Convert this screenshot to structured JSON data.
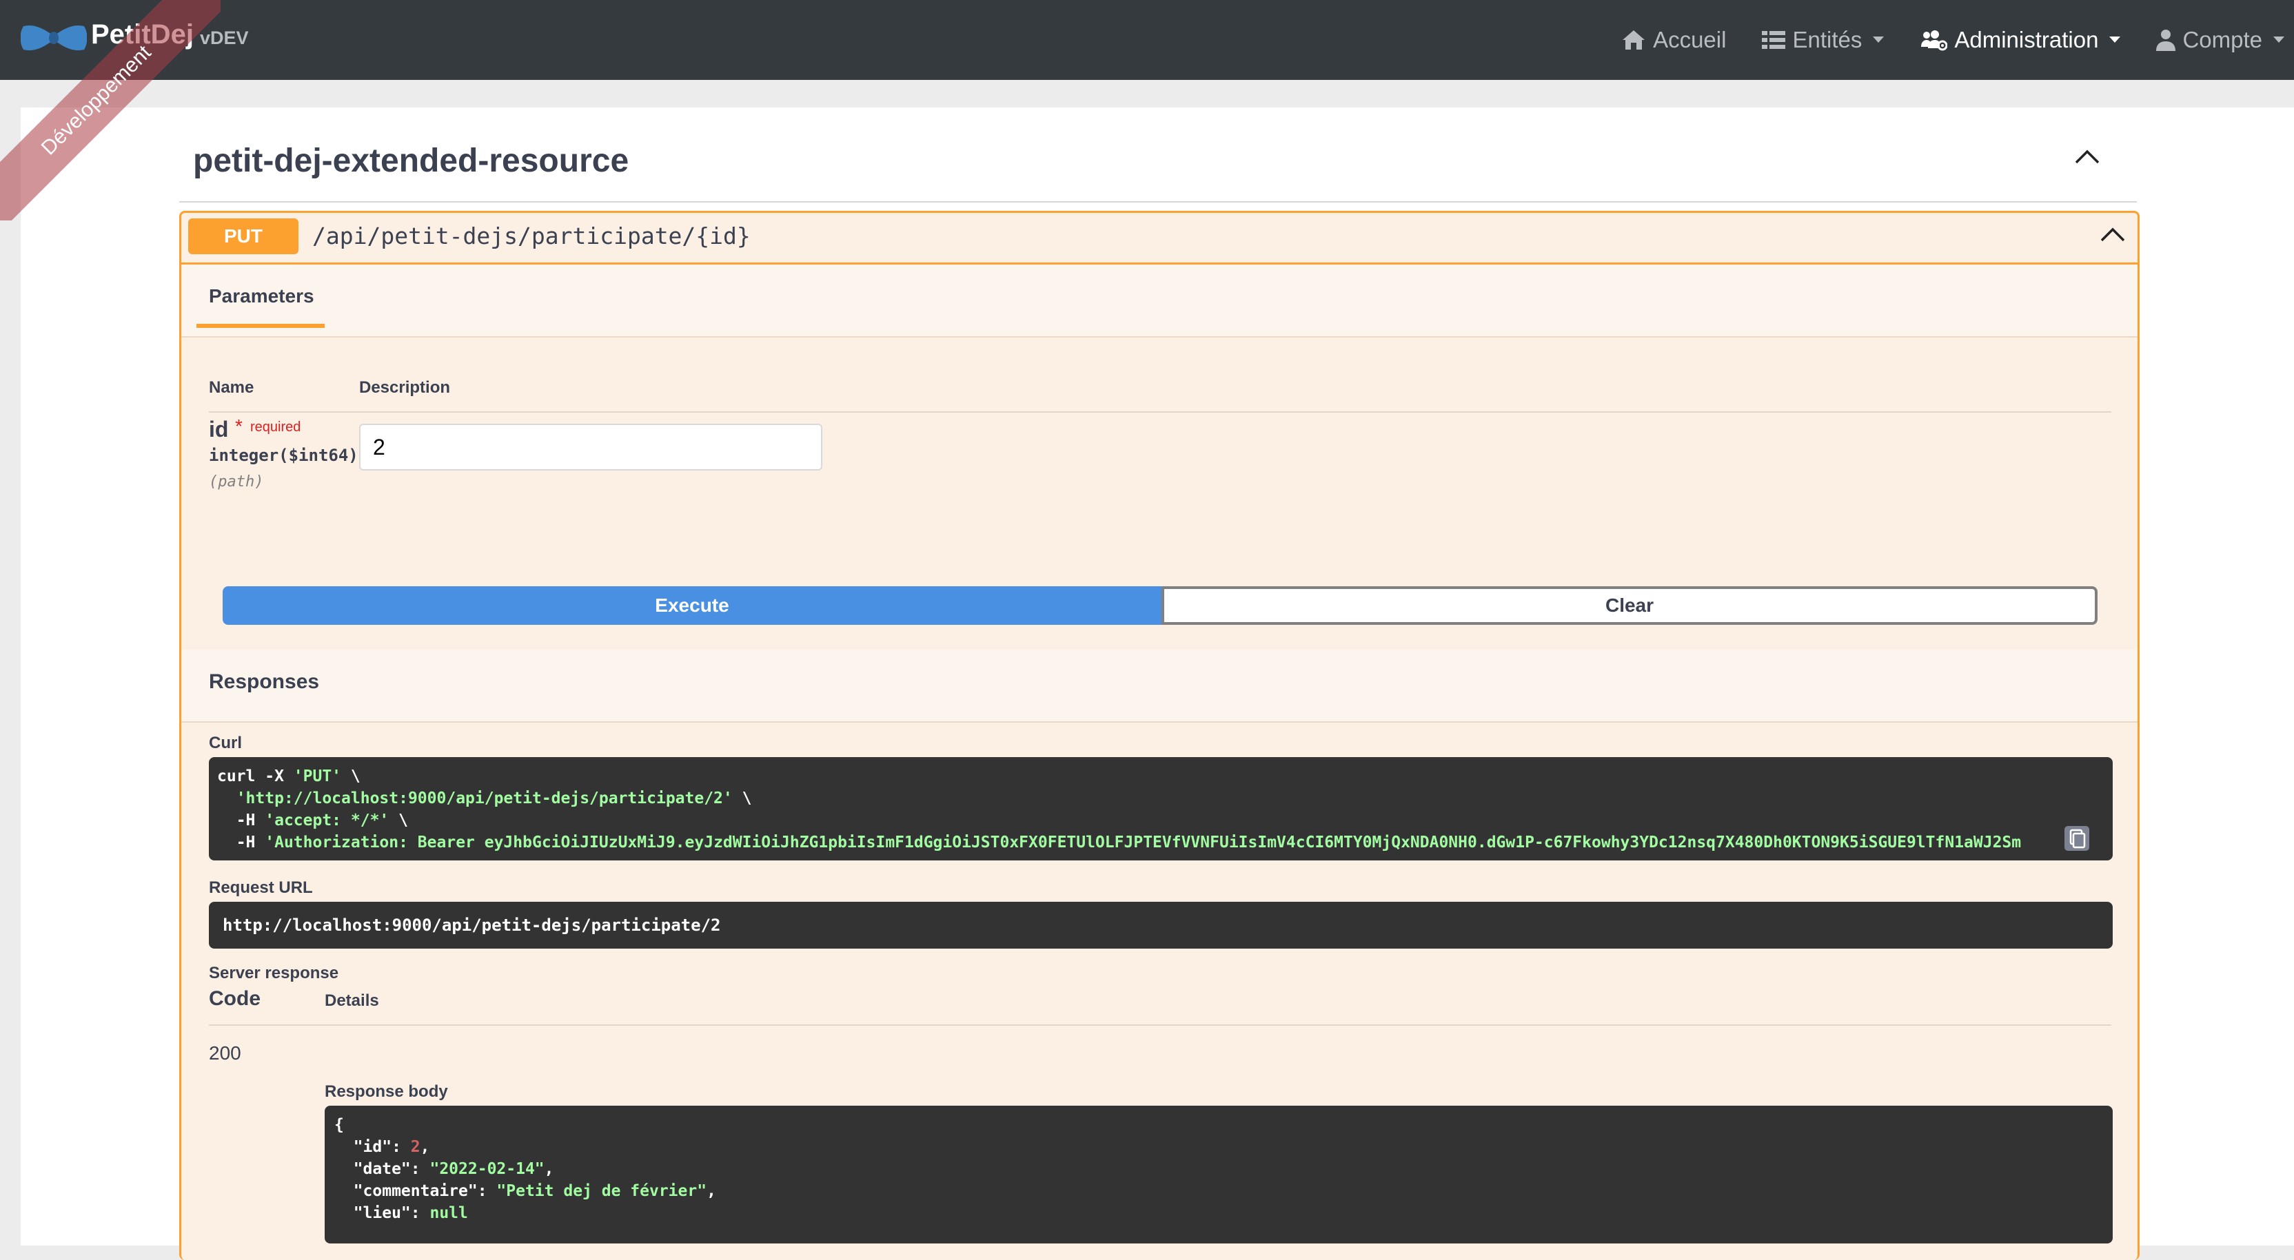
{
  "brand": {
    "name": "PetitDej",
    "version": "vDEV",
    "ribbon": "Développement"
  },
  "nav": {
    "home": "Accueil",
    "entities": "Entités",
    "admin": "Administration",
    "account": "Compte"
  },
  "tag": {
    "title": "petit-dej-extended-resource"
  },
  "operation": {
    "method": "PUT",
    "path": "/api/petit-dejs/participate/{id}",
    "tab_parameters": "Parameters"
  },
  "params": {
    "col_name": "Name",
    "col_description": "Description",
    "name": "id",
    "star": "*",
    "required": "required",
    "type": "integer($int64)",
    "in": "(path)",
    "value": "2"
  },
  "buttons": {
    "execute": "Execute",
    "clear": "Clear"
  },
  "responses": {
    "title": "Responses",
    "curl_label": "Curl",
    "curl": {
      "l1_a": "curl -X ",
      "l1_b": "'PUT'",
      "l1_c": " \\",
      "l2_a": "  ",
      "l2_b": "'http://localhost:9000/api/petit-dejs/participate/2'",
      "l2_c": " \\",
      "l3_a": "  -H ",
      "l3_b": "'accept: */*'",
      "l3_c": " \\",
      "l4_a": "  -H ",
      "l4_b": "'Authorization: Bearer eyJhbGciOiJIUzUxMiJ9.eyJzdWIiOiJhZG1pbiIsImF1dGgiOiJST0xFX0FETUlOLFJPTEVfVVNFUiIsImV4cCI6MTY0MjQxNDA0NH0.dGw1P-c67Fkowhy3YDc12nsq7X480Dh0KTON9K5iSGUE9lTfN1aWJ2Sm"
    },
    "request_url_label": "Request URL",
    "request_url": "http://localhost:9000/api/petit-dejs/participate/2",
    "server_response_label": "Server response",
    "col_code": "Code",
    "col_details": "Details",
    "code": "200",
    "body_label": "Response body",
    "body": {
      "open": "{",
      "id_key": "  \"id\"",
      "id_val": "2",
      "date_key": "  \"date\"",
      "date_val": "\"2022-02-14\"",
      "comment_key": "  \"commentaire\"",
      "comment_val": "\"Petit dej de février\"",
      "lieu_key": "  \"lieu\"",
      "lieu_val": "null"
    }
  },
  "colors": {
    "navbar": "#353a3f",
    "put": "#fca130",
    "execute": "#4990e2",
    "code_bg": "#333333"
  }
}
